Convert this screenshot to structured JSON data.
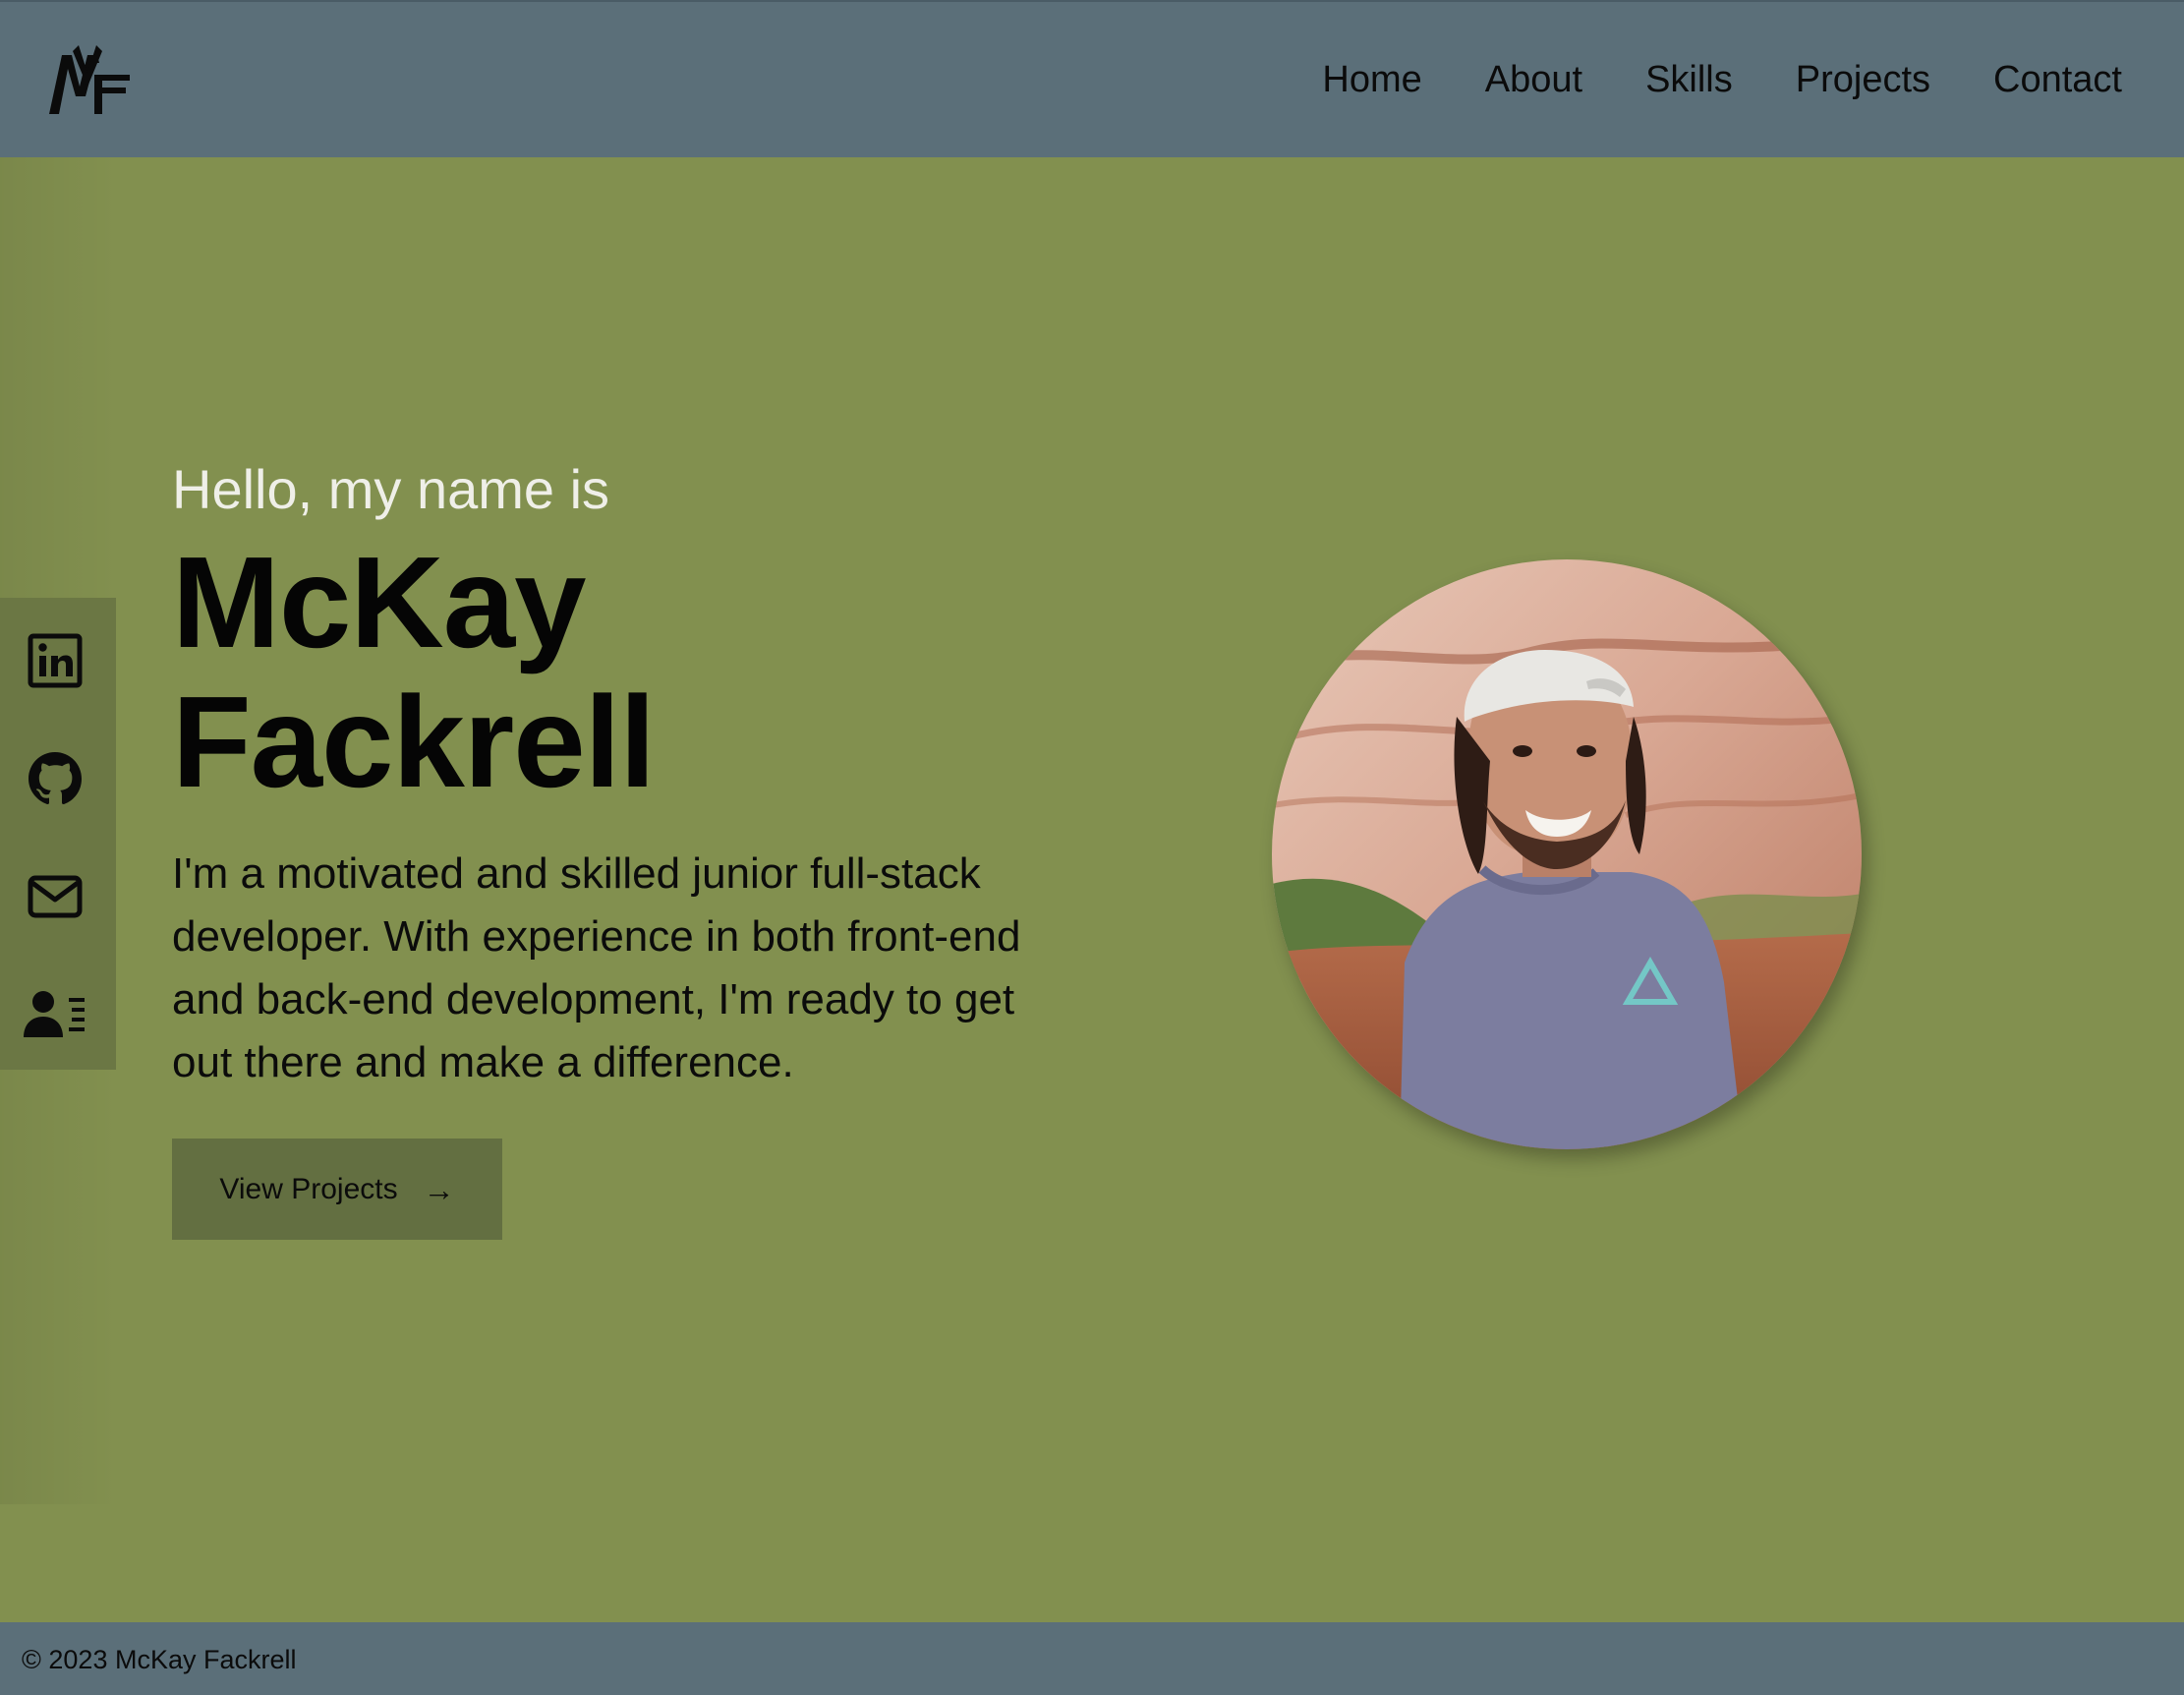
{
  "header": {
    "logo_icon": "mf-monogram-logo",
    "nav": [
      {
        "label": "Home"
      },
      {
        "label": "About"
      },
      {
        "label": "Skills"
      },
      {
        "label": "Projects"
      },
      {
        "label": "Contact"
      }
    ]
  },
  "social": [
    {
      "icon": "linkedin-icon"
    },
    {
      "icon": "github-icon"
    },
    {
      "icon": "mail-icon"
    },
    {
      "icon": "resume-contact-icon"
    }
  ],
  "hero": {
    "greeting": "Hello, my name is",
    "first_name": "McKay",
    "last_name": "Fackrell",
    "intro": "I'm a motivated and skilled junior full-stack developer. With experience in both front-end and back-end development, I'm ready to get out there and make a difference.",
    "cta_label": "View Projects",
    "cta_icon": "arrow-right-icon",
    "cta_arrow": "→",
    "portrait_image": "profile-photo"
  },
  "footer": {
    "copyright": "© 2023 McKay Fackrell"
  },
  "colors": {
    "header_bg": "#5b6f79",
    "hero_bg": "#82904f",
    "social_bar_bg": "#6b7744",
    "button_bg": "#636f41",
    "footer_bg": "#5b6f79"
  }
}
